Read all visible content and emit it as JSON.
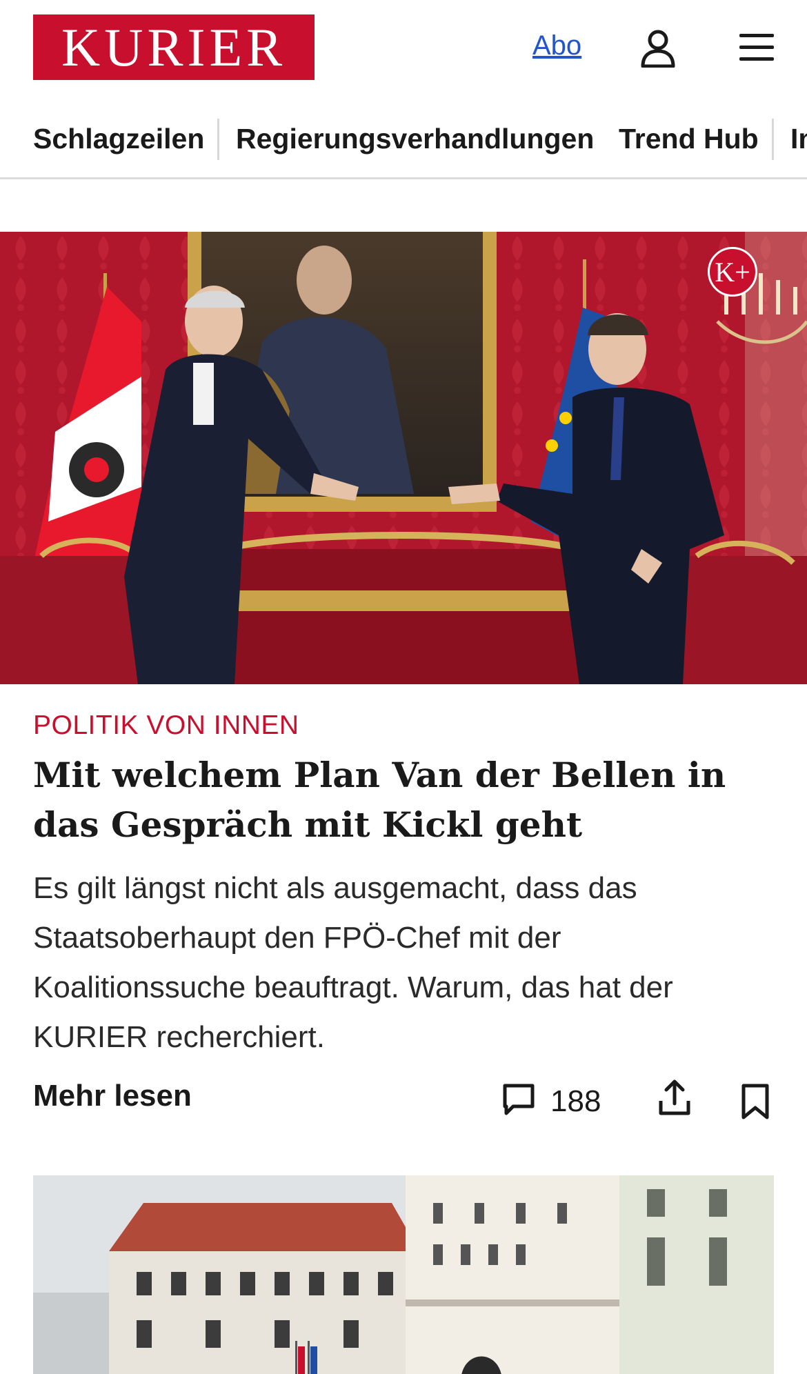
{
  "header": {
    "logo_text": "KURIER",
    "abo_label": "Abo",
    "user_icon": "user-icon",
    "menu_icon": "hamburger-menu-icon"
  },
  "nav": {
    "items": [
      {
        "label": "Schlagzeilen"
      },
      {
        "label": "Regierungsverhandlungen"
      },
      {
        "label": "Trend Hub"
      },
      {
        "label": "In"
      }
    ]
  },
  "article": {
    "badge": "K+",
    "kicker": "POLITIK VON INNEN",
    "headline": "Mit welchem Plan Van der Bellen in das Gespräch mit Kickl geht",
    "teaser": "Es gilt längst nicht als ausgemacht, dass das Staatsoberhaupt den FPÖ-Chef mit der Koalitionssuche beauftragt. Warum, das hat der KURIER recherchiert.",
    "more_label": "Mehr lesen",
    "comment_count": "188",
    "comment_icon": "comment-icon",
    "share_icon": "share-icon",
    "bookmark_icon": "bookmark-icon"
  },
  "colors": {
    "brand": "#c8102e",
    "link": "#2255cc",
    "text": "#1a1a1a"
  }
}
